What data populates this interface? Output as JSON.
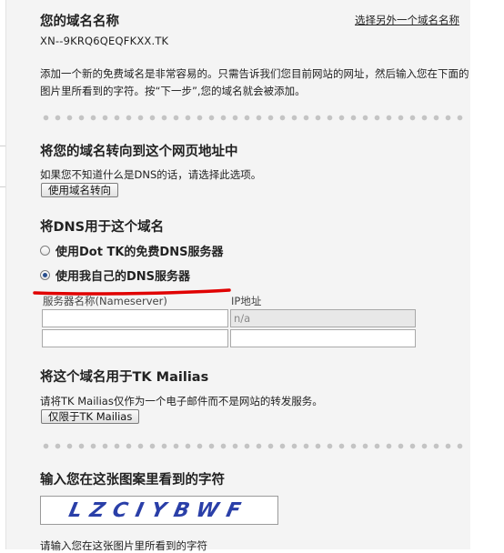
{
  "domain_section": {
    "title": "您的域名名称",
    "choose_other_link": "选择另外一个域名名称",
    "domain_name": "XN--9KRQ6QEQFKXX.TK",
    "description": "添加一个新的免费域名是非常容易的。只需告诉我们您目前网站的网址，然后输入您在下面的图片里所看到的字符。按“下一步”,您的域名就会被添加。"
  },
  "forward_section": {
    "title": "将您的域名转向到这个网页地址中",
    "note": "如果您不知道什么是DNS的话，请选择此选项。",
    "button": "使用域名转向"
  },
  "dns_section": {
    "title": "将DNS用于这个域名",
    "options": [
      {
        "label": "使用Dot TK的免费DNS服务器",
        "checked": false
      },
      {
        "label": "使用我自己的DNS服务器",
        "checked": true
      }
    ],
    "nameserver_header": "服务器名称(Nameserver)",
    "ip_header": "IP地址",
    "rows": [
      {
        "nameserver": "",
        "ip": "n/a",
        "ip_disabled": true
      },
      {
        "nameserver": "",
        "ip": "",
        "ip_disabled": false
      }
    ],
    "annotation_color": "#e00000"
  },
  "mailias_section": {
    "title": "将这个域名用于TK Mailias",
    "note": "请将TK Mailias仅作为一个电子邮件而不是网站的转发服务。",
    "button": "仅限于TK Mailias"
  },
  "captcha_section": {
    "title": "输入您在这张图案里看到的字符",
    "captcha_text": "LZCIYBWF",
    "hint": "请输入您在这张图片里所看到的字符"
  }
}
